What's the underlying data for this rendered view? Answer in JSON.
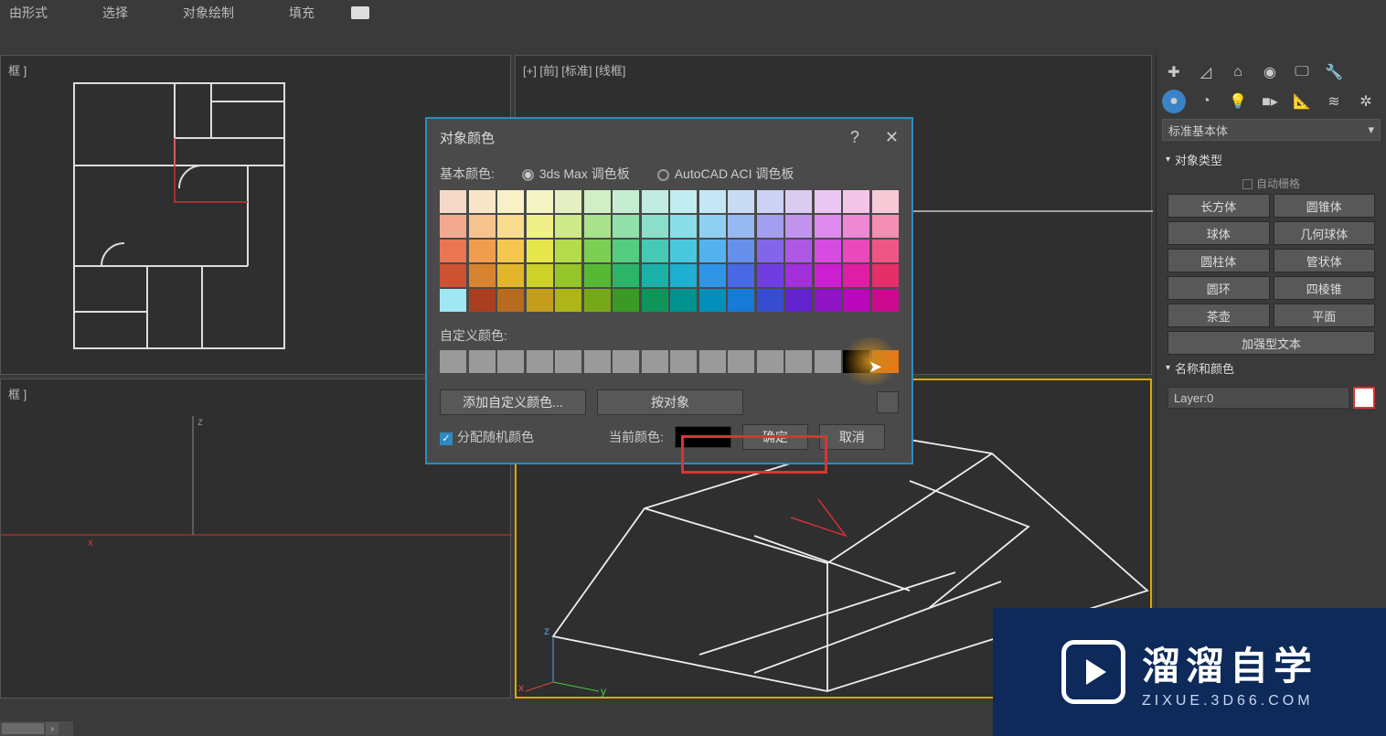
{
  "menu": {
    "freeform": "由形式",
    "select": "选择",
    "objectPaint": "对象绘制",
    "fill": "填充"
  },
  "viewport": {
    "left_top": "框 ]",
    "right_top": "[+] [前] [标准] [线框]",
    "left_bottom": "框 ]"
  },
  "dialog": {
    "title": "对象颜色",
    "basicLabel": "基本颜色:",
    "palette3ds": "3ds Max 调色板",
    "paletteAcad": "AutoCAD ACI 调色板",
    "customLabel": "自定义颜色:",
    "addCustom": "添加自定义颜色...",
    "byObject": "按对象",
    "assignRandom": "分配随机颜色",
    "currentColor": "当前颜色:",
    "ok": "确定",
    "cancel": "取消"
  },
  "palette": [
    [
      "#f5d9c8",
      "#f8e6c8",
      "#faf0c8",
      "#f2f4c3",
      "#e4f0c3",
      "#d2eec4",
      "#c6edd0",
      "#c1ece1",
      "#c2ecef",
      "#c4e6f5",
      "#c7dcf4",
      "#cdd1f3",
      "#dcccf2",
      "#eac7f0",
      "#f3c6e7",
      "#f6c9d7"
    ],
    [
      "#f2a98f",
      "#f6c38e",
      "#f9dd8d",
      "#eff08a",
      "#cde98a",
      "#a9e28d",
      "#91e0aa",
      "#89dfca",
      "#8adee8",
      "#8fd0f2",
      "#97b9f0",
      "#a59def",
      "#c294ee",
      "#dc8aeb",
      "#ef88d3",
      "#f38fb2"
    ],
    [
      "#ea7552",
      "#f19d50",
      "#f6c74e",
      "#e5e64a",
      "#b3db4b",
      "#7ccf53",
      "#55cc82",
      "#46cab6",
      "#49c8dd",
      "#54b3ee",
      "#6790eb",
      "#8365e9",
      "#ae59e6",
      "#d64ce0",
      "#ea49bc",
      "#ee5686"
    ],
    [
      "#cc5232",
      "#d8832f",
      "#e2b52c",
      "#cdd128",
      "#95c52a",
      "#57b834",
      "#2cb468",
      "#1bb1a6",
      "#1fafd0",
      "#2e95e7",
      "#4968e3",
      "#703de0",
      "#a12fdb",
      "#cb20d1",
      "#e01da5",
      "#e4306a"
    ],
    [
      "#a1e6f3",
      "#a93e21",
      "#b86b1e",
      "#c39d1b",
      "#adb517",
      "#77a81a",
      "#3a9a25",
      "#0f955a",
      "#00928f",
      "#048fba",
      "#177ad6",
      "#384cd1",
      "#6322cd",
      "#8f15c6",
      "#ba07ba",
      "#cc0a8f"
    ]
  ],
  "panel": {
    "dropdown": "标准基本体",
    "sectionType": "对象类型",
    "autoGrid": "自动栅格",
    "buttons": [
      [
        "长方体",
        "圆锥体"
      ],
      [
        "球体",
        "几何球体"
      ],
      [
        "圆柱体",
        "管状体"
      ],
      [
        "圆环",
        "四棱锥"
      ],
      [
        "茶壶",
        "平面"
      ]
    ],
    "textPlus": "加强型文本",
    "sectionName": "名称和颜色",
    "layerValue": "Layer:0"
  },
  "watermark": {
    "big": "溜溜自学",
    "small": "ZIXUE.3D66.COM"
  }
}
